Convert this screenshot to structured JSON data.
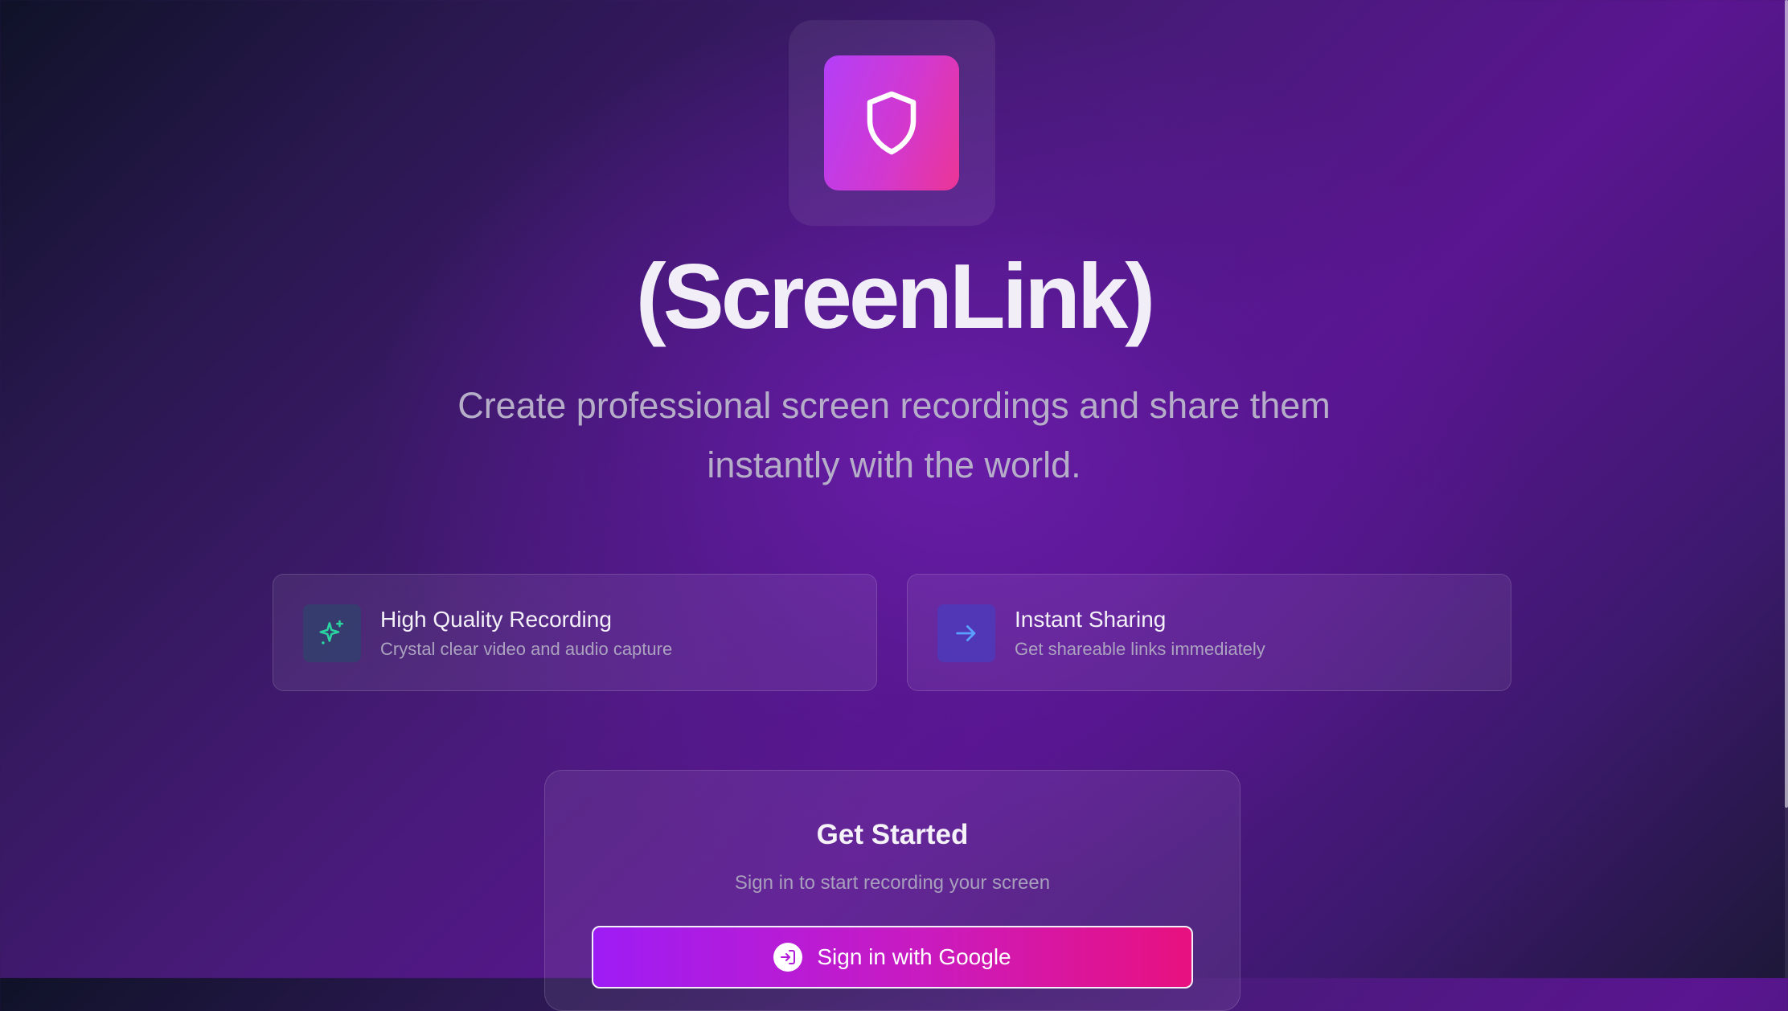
{
  "app": {
    "title": "(ScreenLink)",
    "tagline_line1": "Create professional screen recordings and share them",
    "tagline_line2": "instantly with the world.",
    "logo_icon": "shield-icon"
  },
  "features": [
    {
      "title": "High Quality Recording",
      "description": "Crystal clear video and audio capture",
      "icon": "sparkles-icon"
    },
    {
      "title": "Instant Sharing",
      "description": "Get shareable links immediately",
      "icon": "arrow-right-icon"
    }
  ],
  "signin": {
    "title": "Get Started",
    "subtitle": "Sign in to start recording your screen",
    "button_label": "Sign in with Google",
    "button_icon": "sign-in-icon"
  },
  "colors": {
    "accent_start": "#9e1cf5",
    "accent_end": "#e8117f",
    "logo_start": "#b43ff8",
    "logo_end": "#ec3596",
    "feature_icon_teal": "#2ad4a0",
    "feature_icon_blue": "#5aa0ff"
  }
}
